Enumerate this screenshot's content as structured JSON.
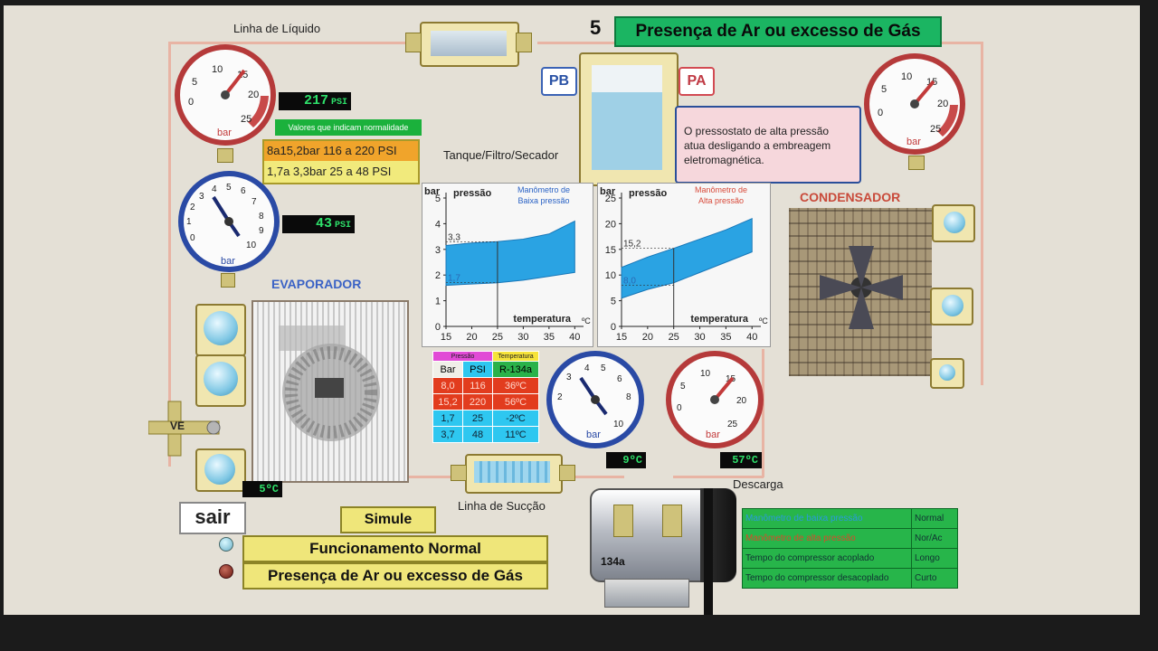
{
  "header": {
    "step": "5",
    "title": "Presença de Ar ou excesso de Gás"
  },
  "labels": {
    "liquid_line": "Linha de Líquido",
    "tank": "Tanque/Filtro/Secador",
    "condenser": "CONDENSADOR",
    "evaporator": "EVAPORADOR",
    "suction_line": "Linha de Sucção",
    "discharge": "Descarga",
    "pb": "PB",
    "pa": "PA",
    "ve": "VE",
    "compressor_label": "134a"
  },
  "gauges": {
    "high_left": {
      "value": "217",
      "unit": "PSI",
      "dial_unit": "bar"
    },
    "low_left": {
      "value": "43",
      "unit": "PSI",
      "dial_unit": "bar"
    },
    "high_right_unit": "bar",
    "low_center_unit": "bar",
    "high_center_unit": "bar"
  },
  "temps": {
    "evap": "5ºC",
    "suction": "9ºC",
    "discharge": "57ºC"
  },
  "normal_values": {
    "title": "Valores que indicam normalidade",
    "high_line": "8a15,2bar 116 a 220 PSI",
    "low_line": "1,7a 3,3bar 25 a 48 PSI"
  },
  "note": "O pressostato de alta pressão atua desligando a embreagem eletromagnética.",
  "pressure_table": {
    "group_headers": [
      "Pressão",
      "Temperatura"
    ],
    "headers": [
      "Bar",
      "PSI",
      "R-134a"
    ],
    "rows": [
      [
        "8,0",
        "116",
        "36ºC"
      ],
      [
        "15,2",
        "220",
        "56ºC"
      ],
      [
        "1,7",
        "25",
        "-2ºC"
      ],
      [
        "3,7",
        "48",
        "11ºC"
      ]
    ]
  },
  "status_table": [
    [
      "Manômetro de baixa pressão",
      "Normal"
    ],
    [
      "Manômetro de alta pressão",
      "Nor/Ac"
    ],
    [
      "Tempo do compressor acoplado",
      "Longo"
    ],
    [
      "Tempo do compressor desacoplado",
      "Curto"
    ]
  ],
  "buttons": {
    "exit": "sair",
    "simulate": "Simule",
    "normal_operation": "Funcionamento Normal",
    "air_excess": "Presença de Ar ou excesso de Gás"
  },
  "chart_data": [
    {
      "type": "area",
      "title": "Manômetro de Baixa pressão",
      "ylabel": "bar",
      "y2label": "pressão",
      "xlabel": "temperatura",
      "xunit": "ºC",
      "x": [
        15,
        20,
        25,
        30,
        35,
        40
      ],
      "yticks": [
        0,
        1,
        2,
        3,
        4,
        5
      ],
      "ylim": [
        0,
        5
      ],
      "xlim": [
        15,
        41
      ],
      "band_lower": [
        [
          15,
          1.6
        ],
        [
          20,
          1.65
        ],
        [
          25,
          1.7
        ],
        [
          30,
          1.8
        ],
        [
          35,
          1.95
        ],
        [
          40,
          2.1
        ]
      ],
      "band_upper": [
        [
          15,
          3.15
        ],
        [
          20,
          3.25
        ],
        [
          25,
          3.3
        ],
        [
          30,
          3.4
        ],
        [
          35,
          3.6
        ],
        [
          40,
          4.1
        ]
      ],
      "annotations": [
        {
          "text": "3,3",
          "x": 15,
          "y": 3.3
        },
        {
          "text": "1,7",
          "x": 15,
          "y": 1.7
        }
      ],
      "marker_x": 25,
      "color": "#2aa3e3"
    },
    {
      "type": "area",
      "title": "Manômetro de Alta pressão",
      "ylabel": "bar",
      "y2label": "pressão",
      "xlabel": "temperatura",
      "xunit": "ºC",
      "x": [
        15,
        20,
        25,
        30,
        35,
        40
      ],
      "yticks": [
        0,
        5,
        10,
        15,
        20,
        25
      ],
      "ylim": [
        0,
        25
      ],
      "xlim": [
        15,
        41
      ],
      "band_lower": [
        [
          15,
          5.5
        ],
        [
          20,
          7.2
        ],
        [
          25,
          8.5
        ],
        [
          30,
          10.5
        ],
        [
          35,
          12.5
        ],
        [
          40,
          14.5
        ]
      ],
      "band_upper": [
        [
          15,
          11.5
        ],
        [
          20,
          13.5
        ],
        [
          25,
          15.2
        ],
        [
          30,
          17.0
        ],
        [
          35,
          18.8
        ],
        [
          40,
          21.0
        ]
      ],
      "annotations": [
        {
          "text": "15,2",
          "x": 15,
          "y": 15.2
        },
        {
          "text": "8,0",
          "x": 15,
          "y": 8.0
        }
      ],
      "marker_x": 25,
      "color": "#2aa3e3"
    }
  ]
}
